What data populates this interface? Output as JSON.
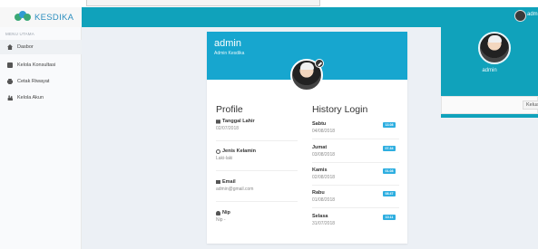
{
  "app": {
    "logo_text": "KESDIKA",
    "header_user": "admin",
    "accent": "#10a2bb"
  },
  "sidebar": {
    "heading": "MENU UTAMA",
    "items": [
      {
        "label": "Dasbor",
        "icon": "home-icon",
        "active": true
      },
      {
        "label": "Kelola Konsultasi",
        "icon": "book-icon",
        "active": false
      },
      {
        "label": "Cetak Riwayat",
        "icon": "print-icon",
        "active": false
      },
      {
        "label": "Kelola Akun",
        "icon": "users-icon",
        "active": false
      }
    ]
  },
  "profile_card": {
    "name": "admin",
    "role": "Admin Kesdika",
    "profile_title": "Profile",
    "fields": [
      {
        "label": "Tanggal Lahir",
        "value": "02/07/2018",
        "icon": "calendar-icon"
      },
      {
        "label": "Jenis Kelamin",
        "value": "Laki-laki",
        "icon": "gender-icon"
      },
      {
        "label": "Email",
        "value": "admin@gmail.com",
        "icon": "envelope-icon"
      },
      {
        "label": "Nip",
        "value": "Nip -",
        "icon": "user-icon"
      }
    ],
    "history_title": "History Login",
    "history": [
      {
        "day": "Sabtu",
        "date": "04/08/2018",
        "time": "13.08"
      },
      {
        "day": "Jumat",
        "date": "03/08/2018",
        "time": "07.34"
      },
      {
        "day": "Kamis",
        "date": "02/08/2018",
        "time": "01.08"
      },
      {
        "day": "Rabu",
        "date": "01/08/2018",
        "time": "08.47"
      },
      {
        "day": "Selasa",
        "date": "31/07/2018",
        "time": "10.11"
      }
    ]
  },
  "right_panel": {
    "name": "admin",
    "logout_label": "Keluar"
  }
}
